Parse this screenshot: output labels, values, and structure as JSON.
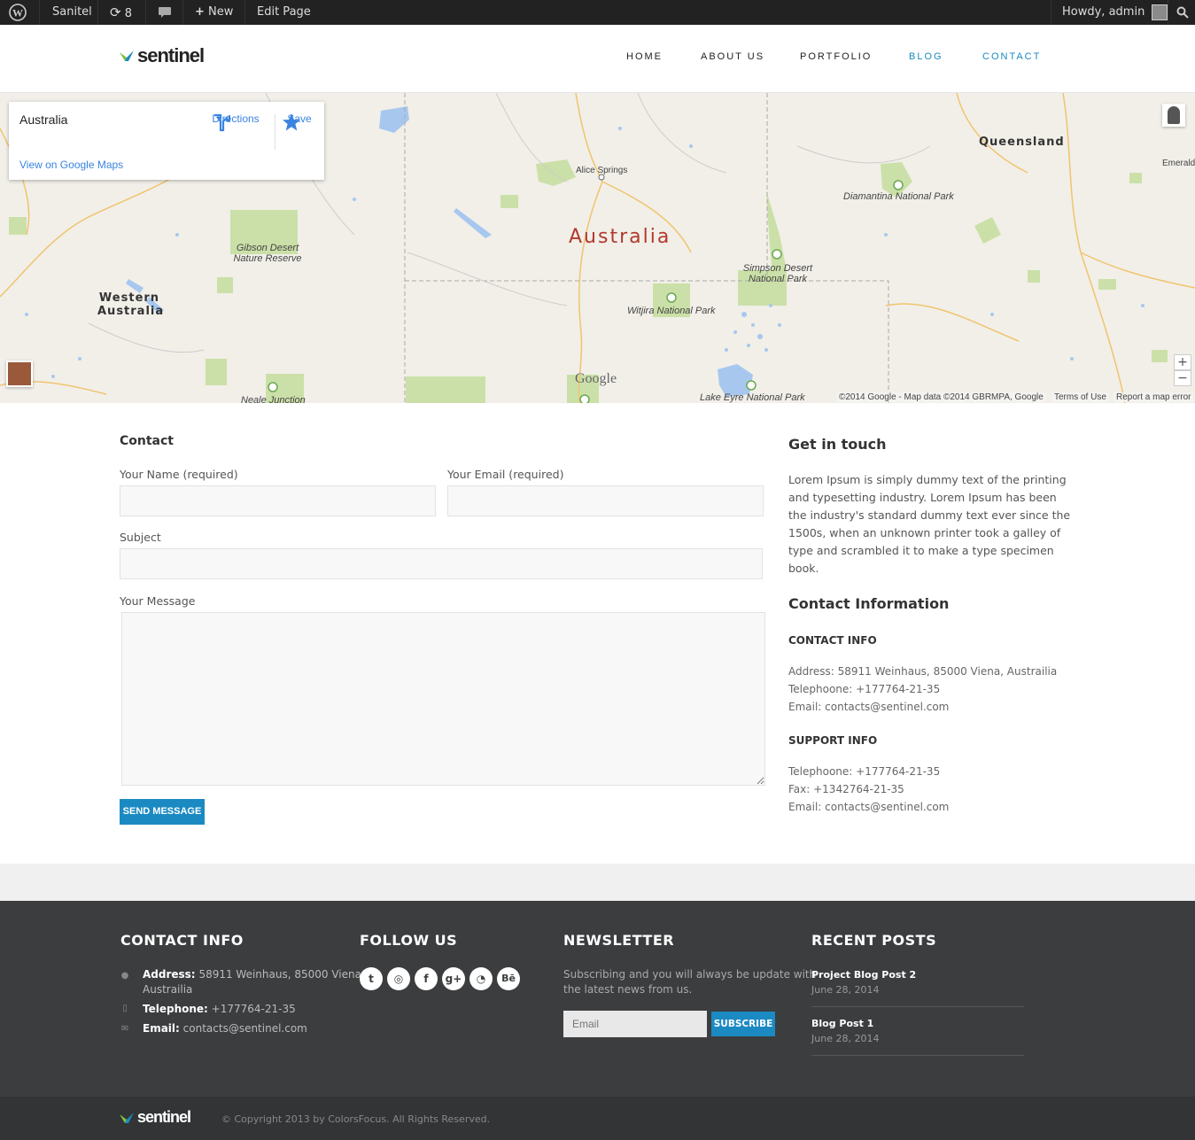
{
  "adminbar": {
    "site_name": "Sanitel",
    "updates_count": "8",
    "new_label": "New",
    "edit_label": "Edit Page",
    "greeting": "Howdy, admin"
  },
  "header": {
    "logo_text": "sentinel",
    "nav": [
      "HOME",
      "ABOUT US",
      "PORTFOLIO",
      "BLOG",
      "CONTACT"
    ],
    "active_nav": "CONTACT",
    "colors": {
      "accent": "#1b8ac2",
      "logo_green": "#7cc142"
    }
  },
  "map": {
    "info": {
      "place": "Australia",
      "directions_label": "Directions",
      "save_label": "Save",
      "view_link": "View on Google Maps"
    },
    "labels": {
      "country": "Australia",
      "queensland": "Queensland",
      "western_australia": "Western Australia",
      "alice_springs": "Alice Springs",
      "emerald": "Emerald",
      "diamantina": "Diamantina National Park",
      "gibson": "Gibson Desert Nature Reserve",
      "simpson": "Simpson Desert National Park",
      "witjira": "Witjira National Park",
      "neale": "Neale Junction",
      "lake_eyre": "Lake Eyre National Park"
    },
    "wordmark": "Google",
    "attribution": "©2014 Google - Map data ©2014 GBRMPA, Google",
    "terms": "Terms of Use",
    "report": "Report a map error",
    "zoom_in": "+",
    "zoom_out": "−"
  },
  "contact_form": {
    "heading": "Contact",
    "name_label": "Your Name (required)",
    "email_label": "Your Email (required)",
    "subject_label": "Subject",
    "message_label": "Your Message",
    "submit_label": "SEND MESSAGE"
  },
  "sidebar": {
    "get_in_touch_heading": "Get in touch",
    "get_in_touch_text": "Lorem Ipsum is simply dummy text of the printing and typesetting industry. Lorem Ipsum has been the industry's standard dummy text ever since the 1500s, when an unknown printer took a galley of type and scrambled it to make a type specimen book.",
    "contact_info_heading": "Contact Information",
    "contact_sub": "CONTACT INFO",
    "contact_lines": [
      "Address: 58911 Weinhaus, 85000 Viena, Austrailia",
      "Telephoone: +177764-21-35",
      "Email: contacts@sentinel.com"
    ],
    "support_sub": "SUPPORT INFO",
    "support_lines": [
      "Telephoone: +177764-21-35",
      "Fax: +1342764-21-35",
      "Email: contacts@sentinel.com"
    ]
  },
  "footer": {
    "contact_heading": "CONTACT INFO",
    "address_key": "Address:",
    "address_val_1": "58911 Weinhaus, 85000 Viena,",
    "address_val_2": "Austrailia",
    "phone_key": "Telephone:",
    "phone_val": "+177764-21-35",
    "email_key": "Email:",
    "email_val": "contacts@sentinel.com",
    "follow_heading": "FOLLOW US",
    "social_icons": [
      "twitter-icon",
      "dribbble-icon",
      "facebook-icon",
      "google-plus-icon",
      "rss-icon",
      "behance-icon"
    ],
    "newsletter_heading": "NEWSLETTER",
    "newsletter_text_1": "Subscribing and you will always be update with",
    "newsletter_text_2": "the latest news from us.",
    "email_placeholder": "Email",
    "subscribe_label": "SUBSCRIBE",
    "posts_heading": "RECENT POSTS",
    "posts": [
      {
        "title": "Project Blog Post 2",
        "date": "June 28, 2014"
      },
      {
        "title": "Blog Post 1",
        "date": "June 28, 2014"
      }
    ]
  },
  "bottombar": {
    "logo_text": "sentinel",
    "copyright": "© Copyright 2013 by ColorsFocus. All Rights Reserved."
  }
}
